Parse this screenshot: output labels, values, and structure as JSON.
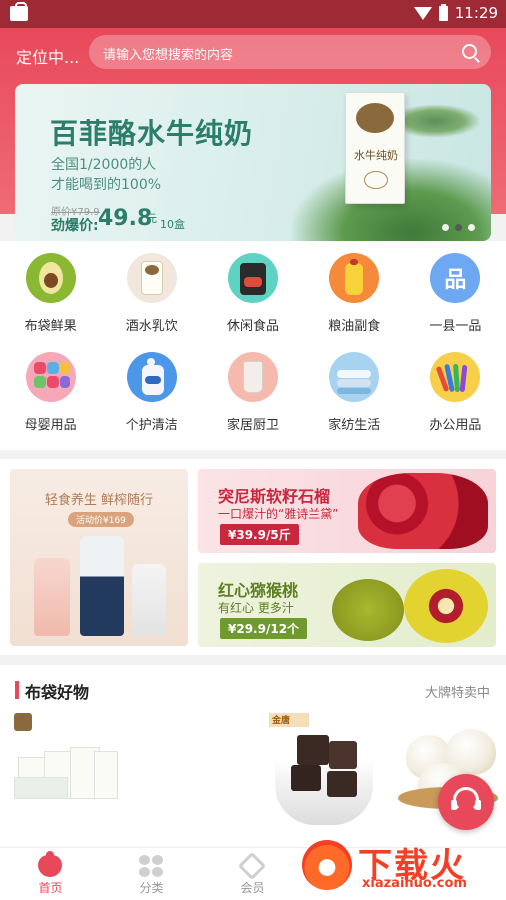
{
  "status_bar": {
    "time": "11:29",
    "icons": [
      "bag-icon",
      "wifi-icon",
      "battery-icon"
    ]
  },
  "header": {
    "location": "定位中...",
    "search_placeholder": "请输入您想搜索的内容",
    "search_icon": "search-icon",
    "accent_color": "#e8495a"
  },
  "banner": {
    "title": "百菲酪水牛纯奶",
    "subtitle_line1": "全国1/2000的人",
    "subtitle_line2": "才能喝到的100%",
    "old_price": "原价¥79.9",
    "price_label": "劲爆价:",
    "price": "49.8",
    "price_unit": "元",
    "quantity": "10盒",
    "product_box_text": "水牛纯奶",
    "carousel_dots": 3,
    "carousel_active_index": 1
  },
  "categories": [
    {
      "label": "布袋鲜果",
      "icon": "avocado-icon"
    },
    {
      "label": "酒水乳饮",
      "icon": "milk-box-icon"
    },
    {
      "label": "休闲食品",
      "icon": "snack-bag-icon"
    },
    {
      "label": "粮油副食",
      "icon": "oil-bottle-icon"
    },
    {
      "label": "一县一品",
      "icon": "pin-character-icon",
      "icon_text": "品"
    },
    {
      "label": "母婴用品",
      "icon": "toy-blocks-icon"
    },
    {
      "label": "个护清洁",
      "icon": "soap-bottle-icon"
    },
    {
      "label": "家居厨卫",
      "icon": "cup-icon"
    },
    {
      "label": "家纺生活",
      "icon": "bedding-icon"
    },
    {
      "label": "办公用品",
      "icon": "markers-icon"
    }
  ],
  "promos": {
    "left": {
      "title": "轻食养生 鲜榨随行",
      "tag": "活动价¥169"
    },
    "right_top": {
      "title": "突尼斯软籽石榴",
      "subtitle": "一口爆汁的“雅诗兰黛”",
      "price": "¥39.9/5斤"
    },
    "right_bottom": {
      "title": "红心猕猴桃",
      "subtitle": "有红心 更多汁",
      "price": "¥29.9/12个"
    }
  },
  "section": {
    "title": "布袋好物",
    "more": "大牌特卖中",
    "products": [
      {
        "name": "milk-box-product",
        "brand": ""
      },
      {
        "name": "brown-sugar-product",
        "brand": "金唐"
      },
      {
        "name": "coconut-product",
        "brand": ""
      }
    ]
  },
  "tabbar": [
    {
      "label": "首页",
      "icon": "home-bag-icon",
      "active": true
    },
    {
      "label": "分类",
      "icon": "grid-icon",
      "active": false
    },
    {
      "label": "会员",
      "icon": "diamond-icon",
      "active": false
    },
    {
      "label": "",
      "icon": "",
      "active": false
    },
    {
      "label": "",
      "icon": "",
      "active": false
    }
  ],
  "floating": {
    "icon": "customer-service-headset-icon"
  },
  "watermark": {
    "big_text": "下载火",
    "small_text": "xiazaihuo.com"
  }
}
